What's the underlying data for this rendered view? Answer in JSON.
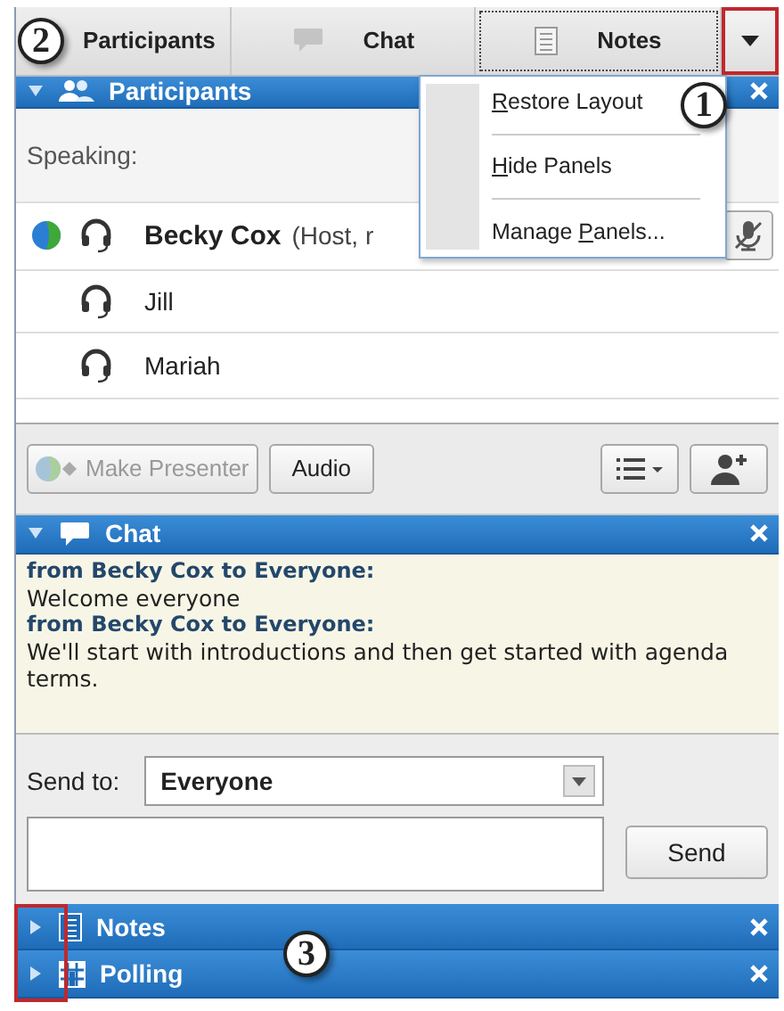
{
  "tabs": [
    {
      "label": "Participants",
      "focused": false
    },
    {
      "label": "Chat",
      "focused": false
    },
    {
      "label": "Notes",
      "focused": true
    }
  ],
  "menu_button": {
    "highlighted": true
  },
  "participants_panel": {
    "title": "Participants",
    "expanded": true,
    "speaking_label": "Speaking:",
    "rows": [
      {
        "name": "Becky Cox",
        "role": "(Host, r",
        "host": true,
        "presenter": true
      },
      {
        "name": "Jill",
        "host": false,
        "presenter": false
      },
      {
        "name": "Mariah",
        "host": false,
        "presenter": false
      }
    ],
    "make_presenter": {
      "label": "Make Presenter",
      "disabled": true
    },
    "audio_button": "Audio"
  },
  "menu": {
    "items": [
      {
        "mnemonic": "R",
        "after": "estore Layout"
      },
      {
        "mnemonic": "H",
        "after": "ide Panels"
      },
      {
        "before": "Manage ",
        "mnemonic": "P",
        "after": "anels..."
      }
    ]
  },
  "chat_panel": {
    "title": "Chat",
    "expanded": true,
    "messages": [
      {
        "from": "from Becky Cox to Everyone:",
        "text": "Welcome everyone"
      },
      {
        "from": "from Becky Cox to Everyone:",
        "text": "We'll start with introductions and then get started with agenda terms."
      }
    ],
    "send_to_label": "Send to:",
    "send_to_value": "Everyone",
    "send_button": "Send"
  },
  "collapsed_panels": {
    "highlighted": true,
    "panels": [
      {
        "title": "Notes",
        "expanded": false
      },
      {
        "title": "Polling",
        "expanded": false
      }
    ]
  },
  "callouts": [
    "1",
    "2",
    "3"
  ]
}
